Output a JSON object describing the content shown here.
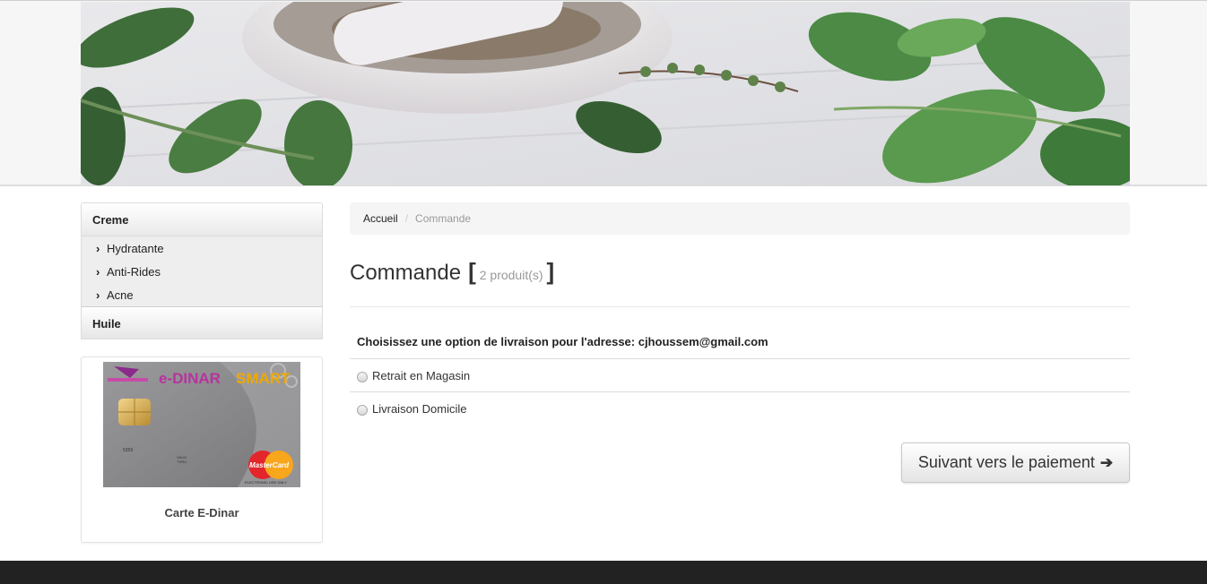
{
  "banner": {
    "icon": "herbs-mortar-banner"
  },
  "sidebar": {
    "categories": [
      {
        "label": "Creme",
        "items": [
          "Hydratante",
          "Anti-Rides",
          "Acne"
        ]
      },
      {
        "label": "Huile",
        "items": []
      }
    ],
    "chevron_icon": "chevron-right-icon"
  },
  "promo": {
    "card_brand": "e-DINAR SMART",
    "caption": "Carte E-Dinar"
  },
  "breadcrumb": {
    "home": "Accueil",
    "separator": "/",
    "current": "Commande"
  },
  "page": {
    "title": "Commande",
    "bracket_open": "[",
    "bracket_close": "]",
    "count": "2 produit(s)"
  },
  "shipping": {
    "heading": "Choisissez une option de livraison pour l'adresse: cjhoussem@gmail.com",
    "options": [
      "Retrait en Magasin",
      "Livraison Domicile"
    ]
  },
  "actions": {
    "next_label": "Suivant vers le paiement",
    "next_icon": "arrow-right-icon"
  }
}
